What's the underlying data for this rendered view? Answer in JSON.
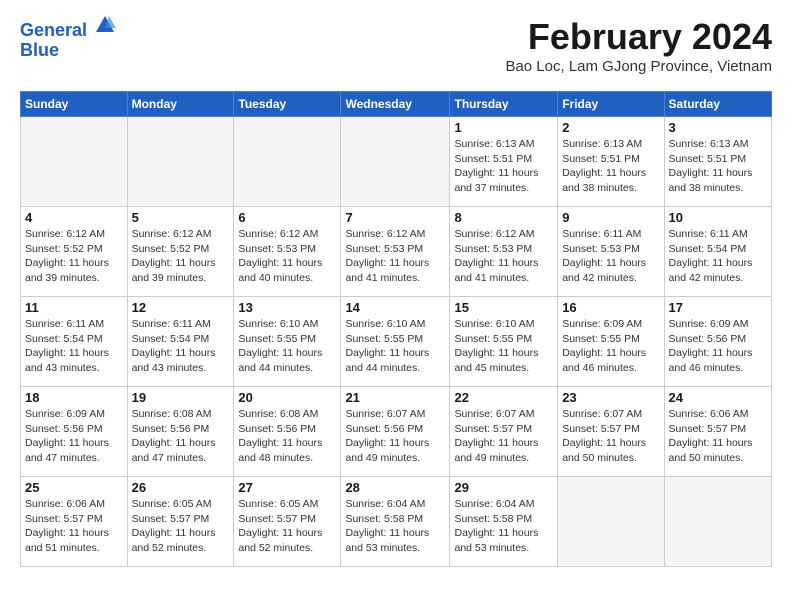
{
  "header": {
    "logo_line1": "General",
    "logo_line2": "Blue",
    "title": "February 2024",
    "location": "Bao Loc, Lam GJong Province, Vietnam"
  },
  "weekdays": [
    "Sunday",
    "Monday",
    "Tuesday",
    "Wednesday",
    "Thursday",
    "Friday",
    "Saturday"
  ],
  "weeks": [
    [
      {
        "day": "",
        "info": ""
      },
      {
        "day": "",
        "info": ""
      },
      {
        "day": "",
        "info": ""
      },
      {
        "day": "",
        "info": ""
      },
      {
        "day": "1",
        "info": "Sunrise: 6:13 AM\nSunset: 5:51 PM\nDaylight: 11 hours\nand 37 minutes."
      },
      {
        "day": "2",
        "info": "Sunrise: 6:13 AM\nSunset: 5:51 PM\nDaylight: 11 hours\nand 38 minutes."
      },
      {
        "day": "3",
        "info": "Sunrise: 6:13 AM\nSunset: 5:51 PM\nDaylight: 11 hours\nand 38 minutes."
      }
    ],
    [
      {
        "day": "4",
        "info": "Sunrise: 6:12 AM\nSunset: 5:52 PM\nDaylight: 11 hours\nand 39 minutes."
      },
      {
        "day": "5",
        "info": "Sunrise: 6:12 AM\nSunset: 5:52 PM\nDaylight: 11 hours\nand 39 minutes."
      },
      {
        "day": "6",
        "info": "Sunrise: 6:12 AM\nSunset: 5:53 PM\nDaylight: 11 hours\nand 40 minutes."
      },
      {
        "day": "7",
        "info": "Sunrise: 6:12 AM\nSunset: 5:53 PM\nDaylight: 11 hours\nand 41 minutes."
      },
      {
        "day": "8",
        "info": "Sunrise: 6:12 AM\nSunset: 5:53 PM\nDaylight: 11 hours\nand 41 minutes."
      },
      {
        "day": "9",
        "info": "Sunrise: 6:11 AM\nSunset: 5:53 PM\nDaylight: 11 hours\nand 42 minutes."
      },
      {
        "day": "10",
        "info": "Sunrise: 6:11 AM\nSunset: 5:54 PM\nDaylight: 11 hours\nand 42 minutes."
      }
    ],
    [
      {
        "day": "11",
        "info": "Sunrise: 6:11 AM\nSunset: 5:54 PM\nDaylight: 11 hours\nand 43 minutes."
      },
      {
        "day": "12",
        "info": "Sunrise: 6:11 AM\nSunset: 5:54 PM\nDaylight: 11 hours\nand 43 minutes."
      },
      {
        "day": "13",
        "info": "Sunrise: 6:10 AM\nSunset: 5:55 PM\nDaylight: 11 hours\nand 44 minutes."
      },
      {
        "day": "14",
        "info": "Sunrise: 6:10 AM\nSunset: 5:55 PM\nDaylight: 11 hours\nand 44 minutes."
      },
      {
        "day": "15",
        "info": "Sunrise: 6:10 AM\nSunset: 5:55 PM\nDaylight: 11 hours\nand 45 minutes."
      },
      {
        "day": "16",
        "info": "Sunrise: 6:09 AM\nSunset: 5:55 PM\nDaylight: 11 hours\nand 46 minutes."
      },
      {
        "day": "17",
        "info": "Sunrise: 6:09 AM\nSunset: 5:56 PM\nDaylight: 11 hours\nand 46 minutes."
      }
    ],
    [
      {
        "day": "18",
        "info": "Sunrise: 6:09 AM\nSunset: 5:56 PM\nDaylight: 11 hours\nand 47 minutes."
      },
      {
        "day": "19",
        "info": "Sunrise: 6:08 AM\nSunset: 5:56 PM\nDaylight: 11 hours\nand 47 minutes."
      },
      {
        "day": "20",
        "info": "Sunrise: 6:08 AM\nSunset: 5:56 PM\nDaylight: 11 hours\nand 48 minutes."
      },
      {
        "day": "21",
        "info": "Sunrise: 6:07 AM\nSunset: 5:56 PM\nDaylight: 11 hours\nand 49 minutes."
      },
      {
        "day": "22",
        "info": "Sunrise: 6:07 AM\nSunset: 5:57 PM\nDaylight: 11 hours\nand 49 minutes."
      },
      {
        "day": "23",
        "info": "Sunrise: 6:07 AM\nSunset: 5:57 PM\nDaylight: 11 hours\nand 50 minutes."
      },
      {
        "day": "24",
        "info": "Sunrise: 6:06 AM\nSunset: 5:57 PM\nDaylight: 11 hours\nand 50 minutes."
      }
    ],
    [
      {
        "day": "25",
        "info": "Sunrise: 6:06 AM\nSunset: 5:57 PM\nDaylight: 11 hours\nand 51 minutes."
      },
      {
        "day": "26",
        "info": "Sunrise: 6:05 AM\nSunset: 5:57 PM\nDaylight: 11 hours\nand 52 minutes."
      },
      {
        "day": "27",
        "info": "Sunrise: 6:05 AM\nSunset: 5:57 PM\nDaylight: 11 hours\nand 52 minutes."
      },
      {
        "day": "28",
        "info": "Sunrise: 6:04 AM\nSunset: 5:58 PM\nDaylight: 11 hours\nand 53 minutes."
      },
      {
        "day": "29",
        "info": "Sunrise: 6:04 AM\nSunset: 5:58 PM\nDaylight: 11 hours\nand 53 minutes."
      },
      {
        "day": "",
        "info": ""
      },
      {
        "day": "",
        "info": ""
      }
    ]
  ]
}
